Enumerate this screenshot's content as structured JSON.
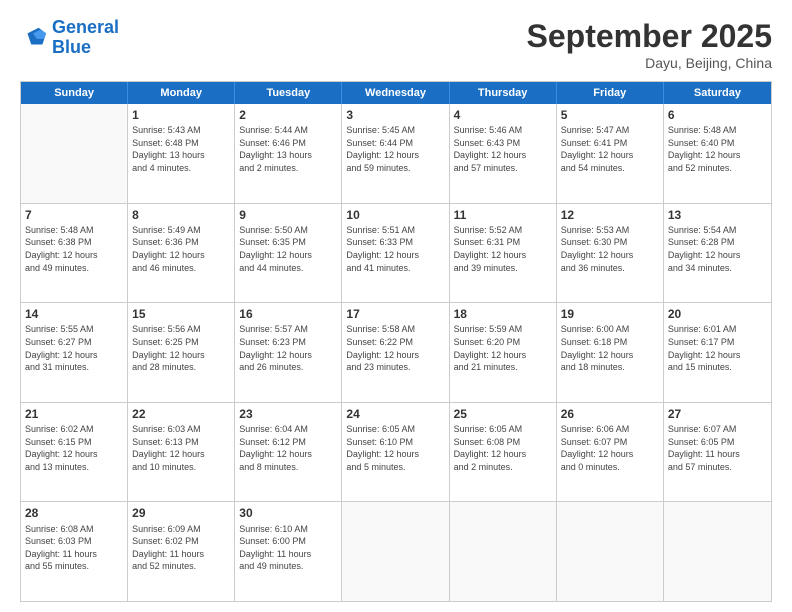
{
  "logo": {
    "line1": "General",
    "line2": "Blue"
  },
  "title": "September 2025",
  "subtitle": "Dayu, Beijing, China",
  "header_days": [
    "Sunday",
    "Monday",
    "Tuesday",
    "Wednesday",
    "Thursday",
    "Friday",
    "Saturday"
  ],
  "weeks": [
    [
      {
        "day": "",
        "info": ""
      },
      {
        "day": "1",
        "info": "Sunrise: 5:43 AM\nSunset: 6:48 PM\nDaylight: 13 hours\nand 4 minutes."
      },
      {
        "day": "2",
        "info": "Sunrise: 5:44 AM\nSunset: 6:46 PM\nDaylight: 13 hours\nand 2 minutes."
      },
      {
        "day": "3",
        "info": "Sunrise: 5:45 AM\nSunset: 6:44 PM\nDaylight: 12 hours\nand 59 minutes."
      },
      {
        "day": "4",
        "info": "Sunrise: 5:46 AM\nSunset: 6:43 PM\nDaylight: 12 hours\nand 57 minutes."
      },
      {
        "day": "5",
        "info": "Sunrise: 5:47 AM\nSunset: 6:41 PM\nDaylight: 12 hours\nand 54 minutes."
      },
      {
        "day": "6",
        "info": "Sunrise: 5:48 AM\nSunset: 6:40 PM\nDaylight: 12 hours\nand 52 minutes."
      }
    ],
    [
      {
        "day": "7",
        "info": "Sunrise: 5:48 AM\nSunset: 6:38 PM\nDaylight: 12 hours\nand 49 minutes."
      },
      {
        "day": "8",
        "info": "Sunrise: 5:49 AM\nSunset: 6:36 PM\nDaylight: 12 hours\nand 46 minutes."
      },
      {
        "day": "9",
        "info": "Sunrise: 5:50 AM\nSunset: 6:35 PM\nDaylight: 12 hours\nand 44 minutes."
      },
      {
        "day": "10",
        "info": "Sunrise: 5:51 AM\nSunset: 6:33 PM\nDaylight: 12 hours\nand 41 minutes."
      },
      {
        "day": "11",
        "info": "Sunrise: 5:52 AM\nSunset: 6:31 PM\nDaylight: 12 hours\nand 39 minutes."
      },
      {
        "day": "12",
        "info": "Sunrise: 5:53 AM\nSunset: 6:30 PM\nDaylight: 12 hours\nand 36 minutes."
      },
      {
        "day": "13",
        "info": "Sunrise: 5:54 AM\nSunset: 6:28 PM\nDaylight: 12 hours\nand 34 minutes."
      }
    ],
    [
      {
        "day": "14",
        "info": "Sunrise: 5:55 AM\nSunset: 6:27 PM\nDaylight: 12 hours\nand 31 minutes."
      },
      {
        "day": "15",
        "info": "Sunrise: 5:56 AM\nSunset: 6:25 PM\nDaylight: 12 hours\nand 28 minutes."
      },
      {
        "day": "16",
        "info": "Sunrise: 5:57 AM\nSunset: 6:23 PM\nDaylight: 12 hours\nand 26 minutes."
      },
      {
        "day": "17",
        "info": "Sunrise: 5:58 AM\nSunset: 6:22 PM\nDaylight: 12 hours\nand 23 minutes."
      },
      {
        "day": "18",
        "info": "Sunrise: 5:59 AM\nSunset: 6:20 PM\nDaylight: 12 hours\nand 21 minutes."
      },
      {
        "day": "19",
        "info": "Sunrise: 6:00 AM\nSunset: 6:18 PM\nDaylight: 12 hours\nand 18 minutes."
      },
      {
        "day": "20",
        "info": "Sunrise: 6:01 AM\nSunset: 6:17 PM\nDaylight: 12 hours\nand 15 minutes."
      }
    ],
    [
      {
        "day": "21",
        "info": "Sunrise: 6:02 AM\nSunset: 6:15 PM\nDaylight: 12 hours\nand 13 minutes."
      },
      {
        "day": "22",
        "info": "Sunrise: 6:03 AM\nSunset: 6:13 PM\nDaylight: 12 hours\nand 10 minutes."
      },
      {
        "day": "23",
        "info": "Sunrise: 6:04 AM\nSunset: 6:12 PM\nDaylight: 12 hours\nand 8 minutes."
      },
      {
        "day": "24",
        "info": "Sunrise: 6:05 AM\nSunset: 6:10 PM\nDaylight: 12 hours\nand 5 minutes."
      },
      {
        "day": "25",
        "info": "Sunrise: 6:05 AM\nSunset: 6:08 PM\nDaylight: 12 hours\nand 2 minutes."
      },
      {
        "day": "26",
        "info": "Sunrise: 6:06 AM\nSunset: 6:07 PM\nDaylight: 12 hours\nand 0 minutes."
      },
      {
        "day": "27",
        "info": "Sunrise: 6:07 AM\nSunset: 6:05 PM\nDaylight: 11 hours\nand 57 minutes."
      }
    ],
    [
      {
        "day": "28",
        "info": "Sunrise: 6:08 AM\nSunset: 6:03 PM\nDaylight: 11 hours\nand 55 minutes."
      },
      {
        "day": "29",
        "info": "Sunrise: 6:09 AM\nSunset: 6:02 PM\nDaylight: 11 hours\nand 52 minutes."
      },
      {
        "day": "30",
        "info": "Sunrise: 6:10 AM\nSunset: 6:00 PM\nDaylight: 11 hours\nand 49 minutes."
      },
      {
        "day": "",
        "info": ""
      },
      {
        "day": "",
        "info": ""
      },
      {
        "day": "",
        "info": ""
      },
      {
        "day": "",
        "info": ""
      }
    ]
  ]
}
